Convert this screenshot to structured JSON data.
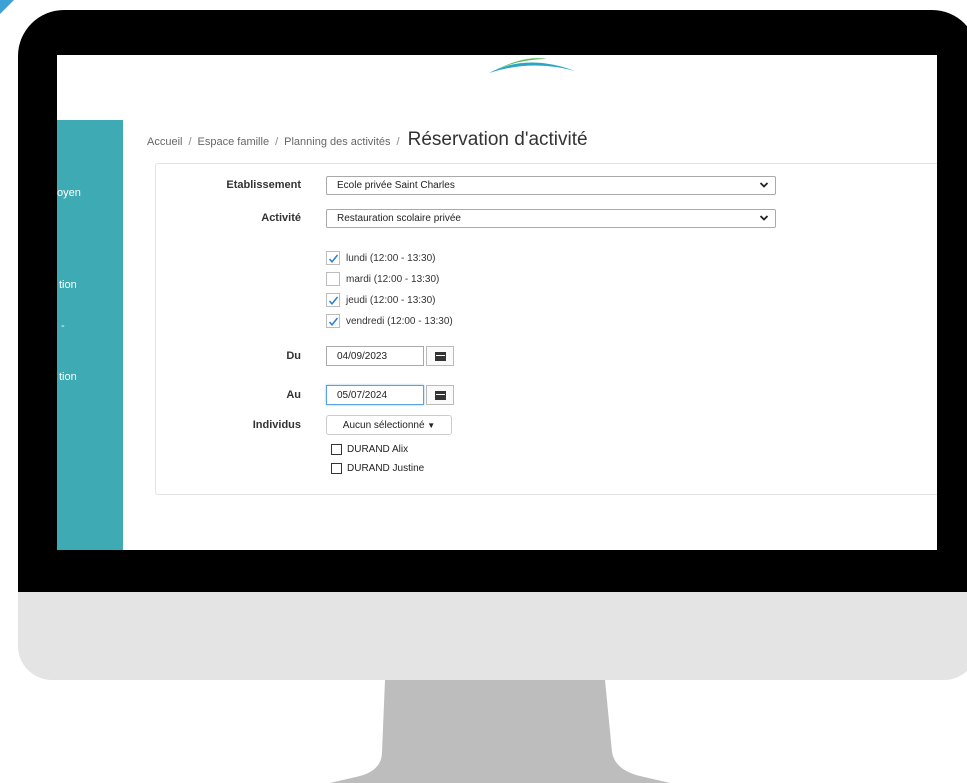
{
  "breadcrumb": {
    "items": [
      "Accueil",
      "Espace famille",
      "Planning des activités"
    ],
    "separator": "/",
    "current": "Réservation d'activité"
  },
  "sidebar": {
    "items": [
      "oyen",
      "tion",
      "-",
      "tion"
    ]
  },
  "form": {
    "etablissement": {
      "label": "Etablissement",
      "value": "Ecole privée Saint Charles"
    },
    "activite": {
      "label": "Activité",
      "value": "Restauration scolaire privée"
    },
    "days": [
      {
        "label": "lundi (12:00 - 13:30)",
        "checked": true
      },
      {
        "label": "mardi (12:00 - 13:30)",
        "checked": false
      },
      {
        "label": "jeudi (12:00 - 13:30)",
        "checked": true
      },
      {
        "label": "vendredi (12:00 - 13:30)",
        "checked": true
      }
    ],
    "du": {
      "label": "Du",
      "value": "04/09/2023"
    },
    "au": {
      "label": "Au",
      "value": "05/07/2024"
    },
    "individus": {
      "label": "Individus",
      "button": "Aucun sélectionné",
      "options": [
        "DURAND Alix",
        "DURAND Justine"
      ]
    }
  },
  "colors": {
    "sidebar": "#3eaab3",
    "check": "#2a7fd4",
    "bezel": "#000000",
    "chin": "#e4e4e4",
    "stand": "#bdbdbd"
  }
}
